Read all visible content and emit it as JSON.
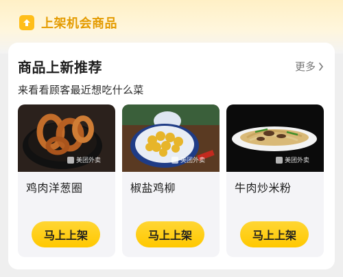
{
  "header": {
    "title": "上架机会商品",
    "icon": "upload-arrow-icon",
    "accent": "#e49b00"
  },
  "section": {
    "title": "商品上新推荐",
    "subtitle": "来看看顾客最近想吃什么菜",
    "more_label": "更多"
  },
  "products": [
    {
      "name": "鸡肉洋葱圈",
      "button": "马上上架",
      "watermark": "美团外卖"
    },
    {
      "name": "椒盐鸡柳",
      "button": "马上上架",
      "watermark": "美团外卖"
    },
    {
      "name": "牛肉炒米粉",
      "button": "马上上架",
      "watermark": "美团外卖"
    }
  ],
  "colors": {
    "button": "#ffcf1a",
    "card_bg": "#f4f4f7"
  }
}
